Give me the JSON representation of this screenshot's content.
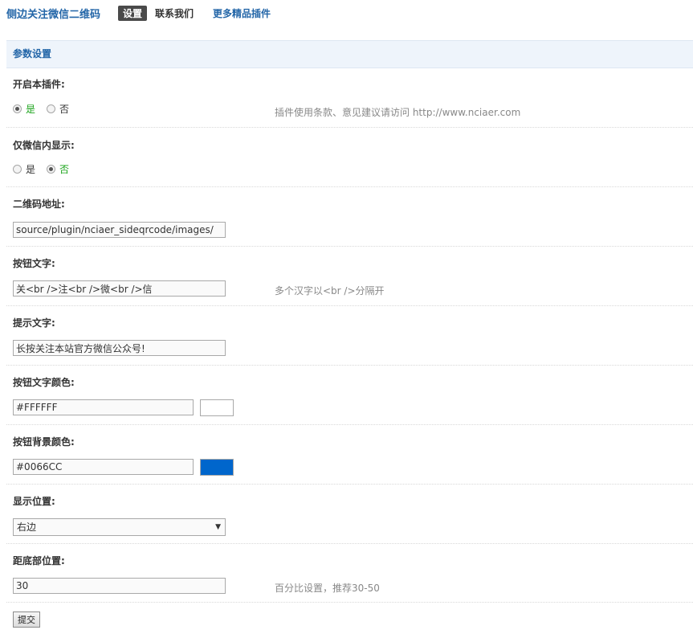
{
  "topnav": {
    "title": "侧边关注微信二维码",
    "tab_settings": "设置",
    "tab_contact": "联系我们",
    "tab_more": "更多精品插件"
  },
  "section": {
    "title": "参数设置"
  },
  "fields": {
    "enable": {
      "label": "开启本插件:",
      "options": [
        "是",
        "否"
      ],
      "selected": "是",
      "hint": "插件使用条款、意见建议请访问 http://www.nciaer.com"
    },
    "wechat_only": {
      "label": "仅微信内显示:",
      "options": [
        "是",
        "否"
      ],
      "selected": "否"
    },
    "qrcode_url": {
      "label": "二维码地址:",
      "value": "source/plugin/nciaer_sideqrcode/images/"
    },
    "button_text": {
      "label": "按钮文字:",
      "value": "关<br />注<br />微<br />信",
      "hint": "多个汉字以<br />分隔开"
    },
    "tip_text": {
      "label": "提示文字:",
      "value": "长按关注本站官方微信公众号!"
    },
    "button_text_color": {
      "label": "按钮文字颜色:",
      "value": "#FFFFFF",
      "swatch": "#FFFFFF"
    },
    "button_bg_color": {
      "label": "按钮背景颜色:",
      "value": "#0066CC",
      "swatch": "#0066CC"
    },
    "position": {
      "label": "显示位置:",
      "selected": "右边"
    },
    "bottom_offset": {
      "label": "距底部位置:",
      "value": "30",
      "hint": "百分比设置，推荐30-50"
    }
  },
  "submit_label": "提交"
}
